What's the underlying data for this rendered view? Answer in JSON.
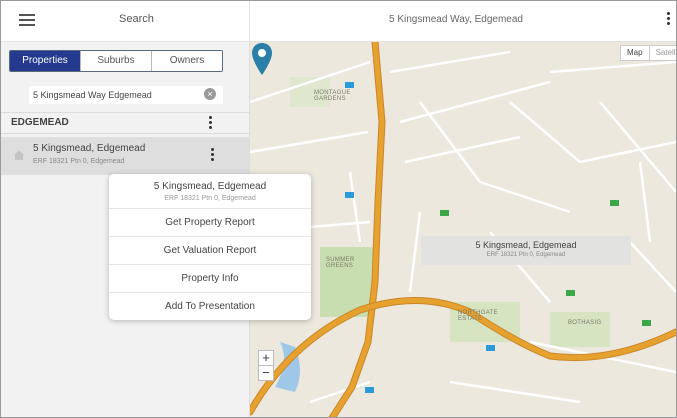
{
  "header": {
    "search_title": "Search",
    "address_title": "5 Kingsmead Way, Edgemead"
  },
  "sidebar": {
    "tabs": [
      {
        "label": "Properties",
        "active": true
      },
      {
        "label": "Suburbs",
        "active": false
      },
      {
        "label": "Owners",
        "active": false
      }
    ],
    "search": {
      "value": "5 Kingsmead Way Edgemead"
    },
    "section": {
      "title": "EDGEMEAD"
    },
    "result": {
      "title": "5 Kingsmead, Edgemead",
      "subtitle": "ERF 18321 Ptn 0, Edgemead"
    }
  },
  "popup": {
    "title": "5 Kingsmead, Edgemead",
    "subtitle": "ERF 18321 Ptn 0, Edgemead",
    "items": [
      {
        "label": "Get Property Report"
      },
      {
        "label": "Get Valuation Report"
      },
      {
        "label": "Property Info"
      },
      {
        "label": "Add To Presentation"
      }
    ]
  },
  "map": {
    "type_toggle": {
      "map": "Map",
      "satellite": "Satellite"
    },
    "zoom_in": "+",
    "zoom_out": "−",
    "callout": {
      "title": "5 Kingsmead, Edgemead",
      "subtitle": "ERF 18321 Ptn 0, Edgemead"
    },
    "area_labels": [
      "MONTAGUE GARDENS",
      "SUMMER GREENS",
      "NORTHGATE ESTATE",
      "BOTHASIG"
    ],
    "colors": {
      "highway": "#e7a12e",
      "marker": "#2a7fa8",
      "park": "#c9deb0",
      "water": "#9fc7e8"
    }
  },
  "colors": {
    "tab_active": "#233a8f",
    "sidebar_bg": "#f2f2f2",
    "selected_row": "#dedede"
  }
}
